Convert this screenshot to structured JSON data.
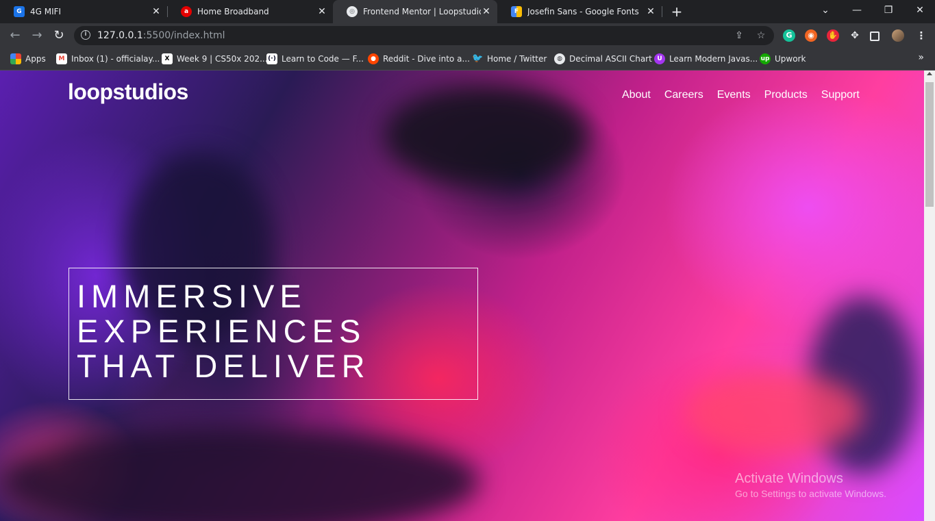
{
  "browser": {
    "tabs": [
      {
        "title": "4G MIFI",
        "icon": "g-icon",
        "active": false
      },
      {
        "title": "Home Broadband",
        "icon": "airtel-icon",
        "active": false
      },
      {
        "title": "Frontend Mentor | Loopstudios la",
        "icon": "globe-icon",
        "active": true
      },
      {
        "title": "Josefin Sans - Google Fonts",
        "icon": "google-fonts-icon",
        "active": false
      }
    ],
    "new_tab": "+",
    "url_host": "127.0.0.1",
    "url_rest": ":5500/index.html",
    "bookmarks": [
      {
        "label": "Apps",
        "icon": "apps-grid-icon"
      },
      {
        "label": "Inbox (1) - officialay...",
        "icon": "gmail-icon"
      },
      {
        "label": "Week 9 | CS50x 202...",
        "icon": "cs50-icon"
      },
      {
        "label": "Learn to Code — F...",
        "icon": "freecodecamp-icon"
      },
      {
        "label": "Reddit - Dive into a...",
        "icon": "reddit-icon"
      },
      {
        "label": "Home / Twitter",
        "icon": "twitter-icon"
      },
      {
        "label": "Decimal ASCII Chart",
        "icon": "globe-icon"
      },
      {
        "label": "Learn Modern Javas...",
        "icon": "js-course-icon"
      },
      {
        "label": "Upwork",
        "icon": "upwork-icon"
      }
    ],
    "bookmarks_more": "»"
  },
  "page": {
    "logo": "loopstudios",
    "nav": [
      "About",
      "Careers",
      "Events",
      "Products",
      "Support"
    ],
    "hero_lines": [
      "IMMERSIVE",
      "EXPERIENCES",
      "THAT DELIVER"
    ]
  },
  "os": {
    "watermark_title": "Activate Windows",
    "watermark_sub": "Go to Settings to activate Windows."
  },
  "colors": {
    "tabbar": "#202124",
    "toolbar": "#35363a",
    "hero_accent": "#ff3ea0"
  }
}
